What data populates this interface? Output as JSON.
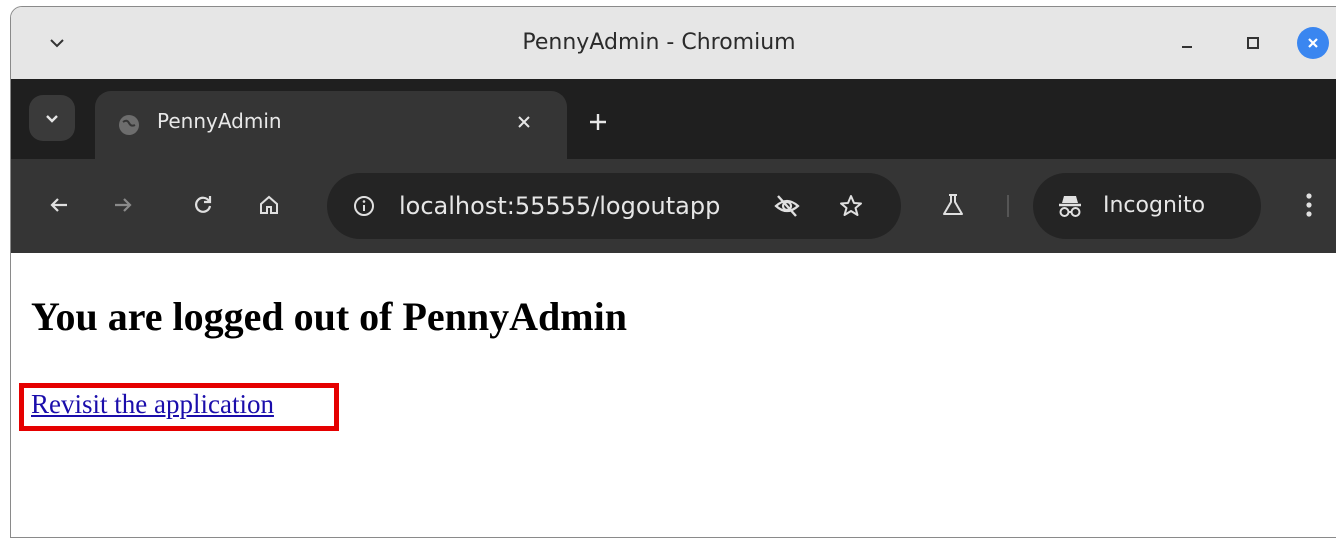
{
  "window": {
    "title": "PennyAdmin - Chromium"
  },
  "tabs": [
    {
      "title": "PennyAdmin"
    }
  ],
  "toolbar": {
    "url": "localhost:55555/logoutapp",
    "incognito_label": "Incognito"
  },
  "page": {
    "heading": "You are logged out of PennyAdmin",
    "link_text": "Revisit the application"
  },
  "colors": {
    "highlight": "#e50000",
    "link": "#1a0dab",
    "close_button": "#3a86f0"
  },
  "icons": [
    "chevron-down-icon",
    "minimize-icon",
    "maximize-icon",
    "close-icon",
    "tab-search-icon",
    "globe-icon",
    "tab-close-icon",
    "new-tab-icon",
    "back-icon",
    "forward-icon",
    "reload-icon",
    "home-icon",
    "info-icon",
    "eye-slash-icon",
    "star-icon",
    "labs-flask-icon",
    "incognito-icon",
    "more-vert-icon"
  ]
}
